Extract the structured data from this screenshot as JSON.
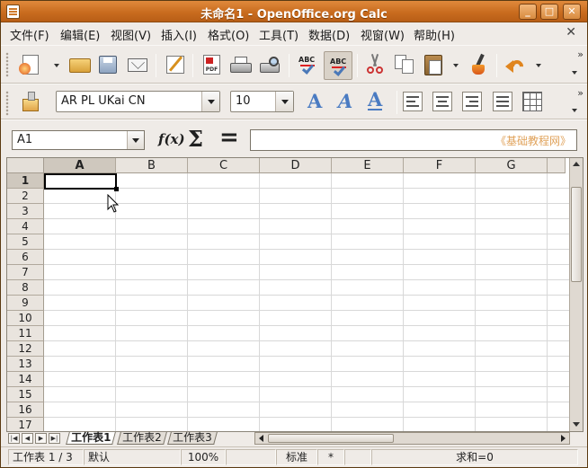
{
  "window": {
    "title": "未命名1 - OpenOffice.org Calc",
    "min_label": "_",
    "max_label": "□",
    "close_label": "✕"
  },
  "menubar": {
    "items": [
      "文件(F)",
      "编辑(E)",
      "视图(V)",
      "插入(I)",
      "格式(O)",
      "工具(T)",
      "数据(D)",
      "视窗(W)",
      "帮助(H)"
    ],
    "close_label": "✕"
  },
  "toolbar_standard": {
    "icons": [
      "new-icon",
      "open-folder-icon",
      "save-icon",
      "mail-icon",
      "edit-file-icon",
      "export-pdf-icon",
      "print-icon",
      "print-preview-icon",
      "spellcheck-icon",
      "auto-spellcheck-icon",
      "cut-icon",
      "copy-icon",
      "paste-icon",
      "format-paintbrush-icon",
      "undo-icon"
    ],
    "pdf_label": "PDF",
    "abc_label": "ABC",
    "overflow": "»"
  },
  "toolbar_format": {
    "font_name": "AR PL UKai CN",
    "font_size": "10",
    "overflow": "»"
  },
  "formula_bar": {
    "name_box": "A1",
    "fx_label": "f(x)",
    "sigma_label": "Σ",
    "equals_label": "=",
    "input_value": "",
    "watermark": "《基础教程网》"
  },
  "sheet": {
    "columns": [
      "A",
      "B",
      "C",
      "D",
      "E",
      "F",
      "G"
    ],
    "rows": [
      "1",
      "2",
      "3",
      "4",
      "5",
      "6",
      "7",
      "8",
      "9",
      "10",
      "11",
      "12",
      "13",
      "14",
      "15",
      "16",
      "17"
    ],
    "active_cell": "A1"
  },
  "tabs": {
    "sheets": [
      "工作表1",
      "工作表2",
      "工作表3"
    ],
    "active": "工作表1",
    "nav": [
      "|◀",
      "◀",
      "▶",
      "▶|"
    ]
  },
  "statusbar": {
    "sheet_pos": "工作表 1 / 3",
    "page_style": "默认",
    "zoom": "100%",
    "mode": "标准",
    "modified": "*",
    "sum": "求和=0"
  },
  "colors": {
    "titlebar": "#c96c1f",
    "accent_blue": "#4a7bc2",
    "watermark": "#e0a25a"
  }
}
